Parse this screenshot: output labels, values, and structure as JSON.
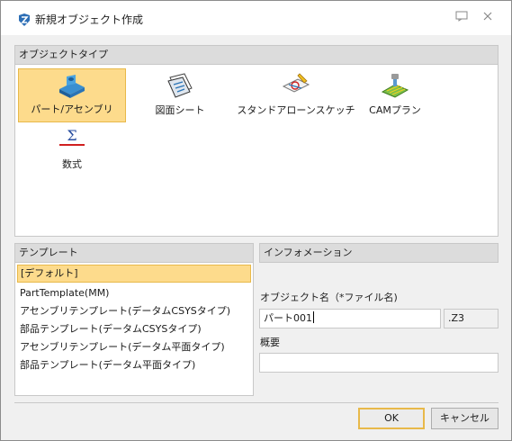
{
  "window": {
    "title": "新規オブジェクト作成"
  },
  "object_types": {
    "header": "オブジェクトタイプ",
    "items": [
      {
        "label": "パート/アセンブリ",
        "icon": "part-assembly-icon",
        "selected": true
      },
      {
        "label": "図面シート",
        "icon": "drawing-sheet-icon",
        "selected": false
      },
      {
        "label": "スタンドアローンスケッチ",
        "icon": "standalone-sketch-icon",
        "selected": false
      },
      {
        "label": "CAMプラン",
        "icon": "cam-plan-icon",
        "selected": false
      },
      {
        "label": "数式",
        "icon": "sigma-icon",
        "selected": false
      }
    ]
  },
  "templates": {
    "header": "テンプレート",
    "items": [
      {
        "label": "[デフォルト]",
        "selected": true
      },
      {
        "label": "PartTemplate(MM)",
        "selected": false
      },
      {
        "label": "アセンブリテンプレート(データムCSYSタイプ)",
        "selected": false
      },
      {
        "label": "部品テンプレート(データムCSYSタイプ)",
        "selected": false
      },
      {
        "label": "アセンブリテンプレート(データム平面タイプ)",
        "selected": false
      },
      {
        "label": "部品テンプレート(データム平面タイプ)",
        "selected": false
      }
    ]
  },
  "information": {
    "header": "インフォメーション",
    "name_label": "オブジェクト名（*ファイル名)",
    "name_value": "パート001",
    "extension": ".Z3",
    "summary_label": "概要",
    "summary_value": ""
  },
  "buttons": {
    "ok": "OK",
    "cancel": "キャンセル"
  },
  "colors": {
    "selection_fill": "#fddb8c",
    "selection_border": "#e8b94a",
    "header_bg": "#dcdcdc"
  }
}
